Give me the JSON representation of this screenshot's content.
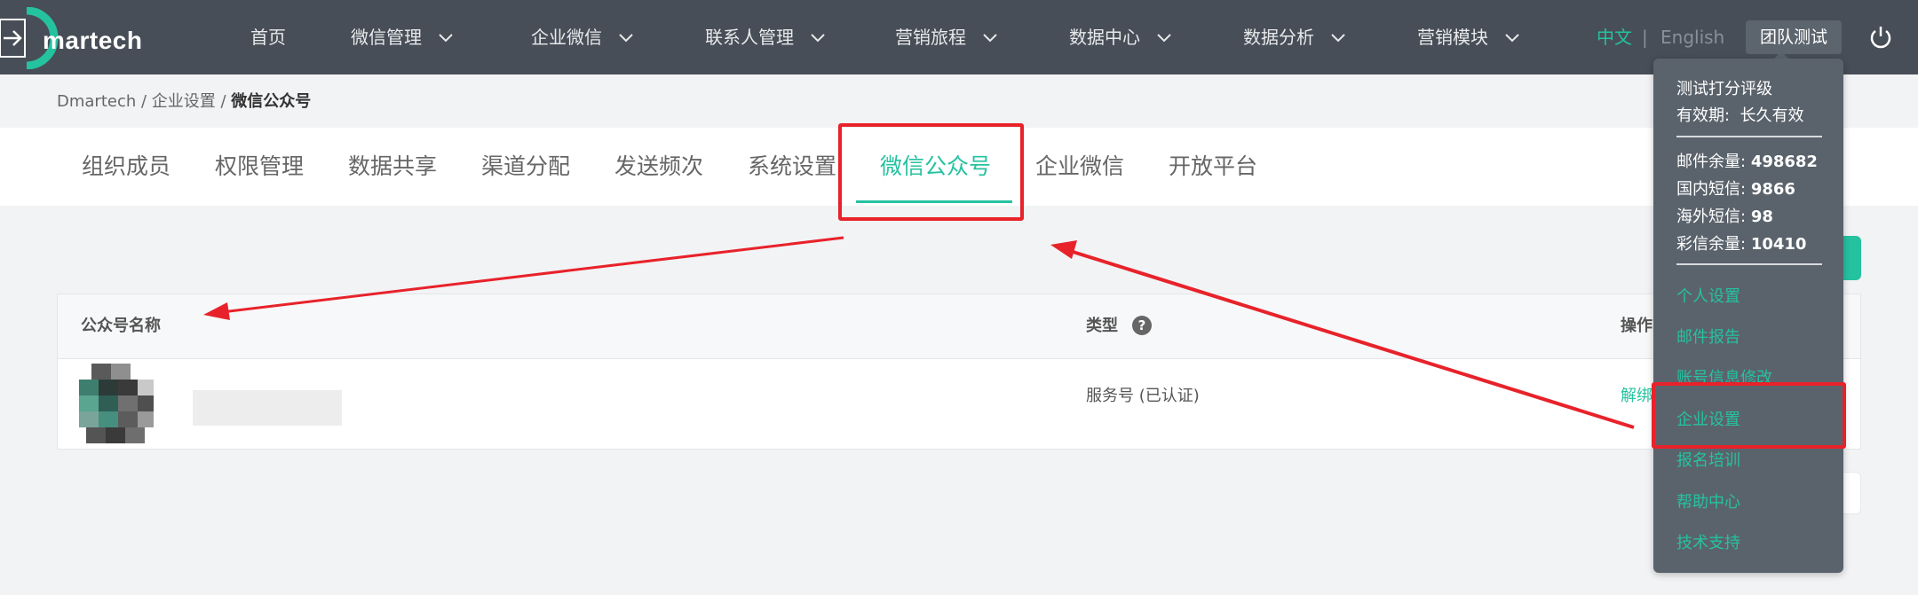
{
  "app": {
    "brand": "martech",
    "logo_icon": "arrow-right-icon"
  },
  "nav": {
    "items": [
      {
        "label": "首页",
        "has_dropdown": false
      },
      {
        "label": "微信管理",
        "has_dropdown": true
      },
      {
        "label": "企业微信",
        "has_dropdown": true
      },
      {
        "label": "联系人管理",
        "has_dropdown": true
      },
      {
        "label": "营销旅程",
        "has_dropdown": true
      },
      {
        "label": "数据中心",
        "has_dropdown": true
      },
      {
        "label": "数据分析",
        "has_dropdown": true
      },
      {
        "label": "营销模块",
        "has_dropdown": true
      }
    ],
    "lang_cn": "中文",
    "lang_sep": "|",
    "lang_en": "English",
    "team": "团队测试"
  },
  "breadcrumb": {
    "root": "Dmartech",
    "sep": " / ",
    "parent": "企业设置",
    "current": "微信公众号"
  },
  "tabs": [
    {
      "label": "组织成员"
    },
    {
      "label": "权限管理"
    },
    {
      "label": "数据共享"
    },
    {
      "label": "渠道分配"
    },
    {
      "label": "发送频次"
    },
    {
      "label": "系统设置"
    },
    {
      "label": "微信公众号",
      "active": true
    },
    {
      "label": "企业微信"
    },
    {
      "label": "开放平台"
    }
  ],
  "table": {
    "headers": {
      "name": "公众号名称",
      "type": "类型",
      "ops": "操作"
    },
    "help_symbol": "?",
    "rows": [
      {
        "type": "服务号 (已认证)",
        "op": "解绑"
      }
    ]
  },
  "dropdown": {
    "plan": "测试打分评级",
    "validity_label": "有效期:",
    "validity_value": "长久有效",
    "quotas": [
      {
        "label": "邮件余量:",
        "value": "498682"
      },
      {
        "label": "国内短信:",
        "value": "9866"
      },
      {
        "label": "海外短信:",
        "value": "98"
      },
      {
        "label": "彩信余量:",
        "value": "10410"
      }
    ],
    "links": [
      "个人设置",
      "邮件报告",
      "账号信息修改",
      "企业设置",
      "报名培训",
      "帮助中心",
      "技术支持"
    ]
  },
  "colors": {
    "accent": "#25c2a0",
    "topbar": "#474e57",
    "annotation": "#e8222a"
  }
}
